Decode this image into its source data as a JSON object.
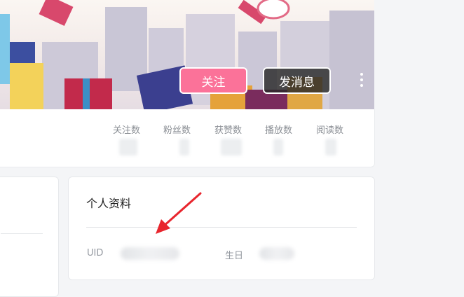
{
  "header": {
    "follow_label": "关注",
    "message_label": "发消息",
    "more_icon": "more-vertical-icon"
  },
  "stats": [
    {
      "label": "关注数"
    },
    {
      "label": "粉丝数"
    },
    {
      "label": "获赞数"
    },
    {
      "label": "播放数"
    },
    {
      "label": "阅读数"
    }
  ],
  "profile": {
    "title": "个人资料",
    "uid_label": "UID",
    "birthday_label": "生日"
  },
  "colors": {
    "accent": "#fb7299",
    "annotation": "#e8262e"
  }
}
